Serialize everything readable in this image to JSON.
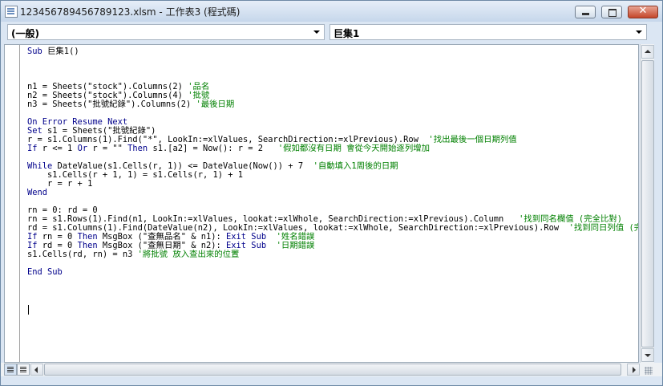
{
  "window": {
    "title": "123456789456789123.xlsm - 工作表3 (程式碼)",
    "buttons": {
      "minimize": "minimize",
      "maximize": "maximize",
      "close": "✕"
    }
  },
  "combos": {
    "object": "(一般)",
    "procedure": "巨集1"
  },
  "code_lines": [
    [
      {
        "t": "kw",
        "s": "Sub "
      },
      {
        "t": "tx",
        "s": "巨集1()"
      }
    ],
    [],
    [],
    [],
    [
      {
        "t": "tx",
        "s": "n1 = Sheets(\"stock\").Columns(2) "
      },
      {
        "t": "cm",
        "s": "'品名"
      }
    ],
    [
      {
        "t": "tx",
        "s": "n2 = Sheets(\"stock\").Columns(4) "
      },
      {
        "t": "cm",
        "s": "'批號"
      }
    ],
    [
      {
        "t": "tx",
        "s": "n3 = Sheets(\"批號紀錄\").Columns(2) "
      },
      {
        "t": "cm",
        "s": "'最後日期"
      }
    ],
    [],
    [
      {
        "t": "kw",
        "s": "On Error Resume Next"
      }
    ],
    [
      {
        "t": "kw",
        "s": "Set "
      },
      {
        "t": "tx",
        "s": "s1 = Sheets(\"批號紀錄\")"
      }
    ],
    [
      {
        "t": "tx",
        "s": "r = s1.Columns(1).Find(\"*\", LookIn:=xlValues, SearchDirection:=xlPrevious).Row  "
      },
      {
        "t": "cm",
        "s": "'找出最後一個日期列值"
      }
    ],
    [
      {
        "t": "kw",
        "s": "If "
      },
      {
        "t": "tx",
        "s": "r <= 1 "
      },
      {
        "t": "kw",
        "s": "Or "
      },
      {
        "t": "tx",
        "s": "r = \"\" "
      },
      {
        "t": "kw",
        "s": "Then "
      },
      {
        "t": "tx",
        "s": "s1.[a2] = Now(): r = 2   "
      },
      {
        "t": "cm",
        "s": "'假如都沒有日期 會從今天開始逐列增加"
      }
    ],
    [],
    [
      {
        "t": "kw",
        "s": "While "
      },
      {
        "t": "tx",
        "s": "DateValue(s1.Cells(r, 1)) <= DateValue(Now()) + 7  "
      },
      {
        "t": "cm",
        "s": "'自動填入1周後的日期"
      }
    ],
    [
      {
        "t": "tx",
        "s": "    s1.Cells(r + 1, 1) = s1.Cells(r, 1) + 1"
      }
    ],
    [
      {
        "t": "tx",
        "s": "    r = r + 1"
      }
    ],
    [
      {
        "t": "kw",
        "s": "Wend"
      }
    ],
    [],
    [
      {
        "t": "tx",
        "s": "rn = 0: rd = 0"
      }
    ],
    [
      {
        "t": "tx",
        "s": "rn = s1.Rows(1).Find(n1, LookIn:=xlValues, lookat:=xlWhole, SearchDirection:=xlPrevious).Column   "
      },
      {
        "t": "cm",
        "s": "'找到同名欄值 (完全比對)"
      }
    ],
    [
      {
        "t": "tx",
        "s": "rd = s1.Columns(1).Find(DateValue(n2), LookIn:=xlValues, lookat:=xlWhole, SearchDirection:=xlPrevious).Row  "
      },
      {
        "t": "cm",
        "s": "'找到同日列值 (完全"
      }
    ],
    [
      {
        "t": "kw",
        "s": "If "
      },
      {
        "t": "tx",
        "s": "rn = 0 "
      },
      {
        "t": "kw",
        "s": "Then "
      },
      {
        "t": "tx",
        "s": "MsgBox (\"查無品名\" & n1): "
      },
      {
        "t": "kw",
        "s": "Exit Sub  "
      },
      {
        "t": "cm",
        "s": "'姓名錯誤"
      }
    ],
    [
      {
        "t": "kw",
        "s": "If "
      },
      {
        "t": "tx",
        "s": "rd = 0 "
      },
      {
        "t": "kw",
        "s": "Then "
      },
      {
        "t": "tx",
        "s": "MsgBox (\"查無日期\" & n2): "
      },
      {
        "t": "kw",
        "s": "Exit Sub  "
      },
      {
        "t": "cm",
        "s": "'日期錯誤"
      }
    ],
    [
      {
        "t": "tx",
        "s": "s1.Cells(rd, rn) = n3 "
      },
      {
        "t": "cm",
        "s": "'將批號 放入查出來的位置"
      }
    ],
    [],
    [
      {
        "t": "kw",
        "s": "End Sub"
      }
    ]
  ],
  "colors": {
    "keyword": "#00008b",
    "comment": "#008000",
    "text": "#000000"
  }
}
